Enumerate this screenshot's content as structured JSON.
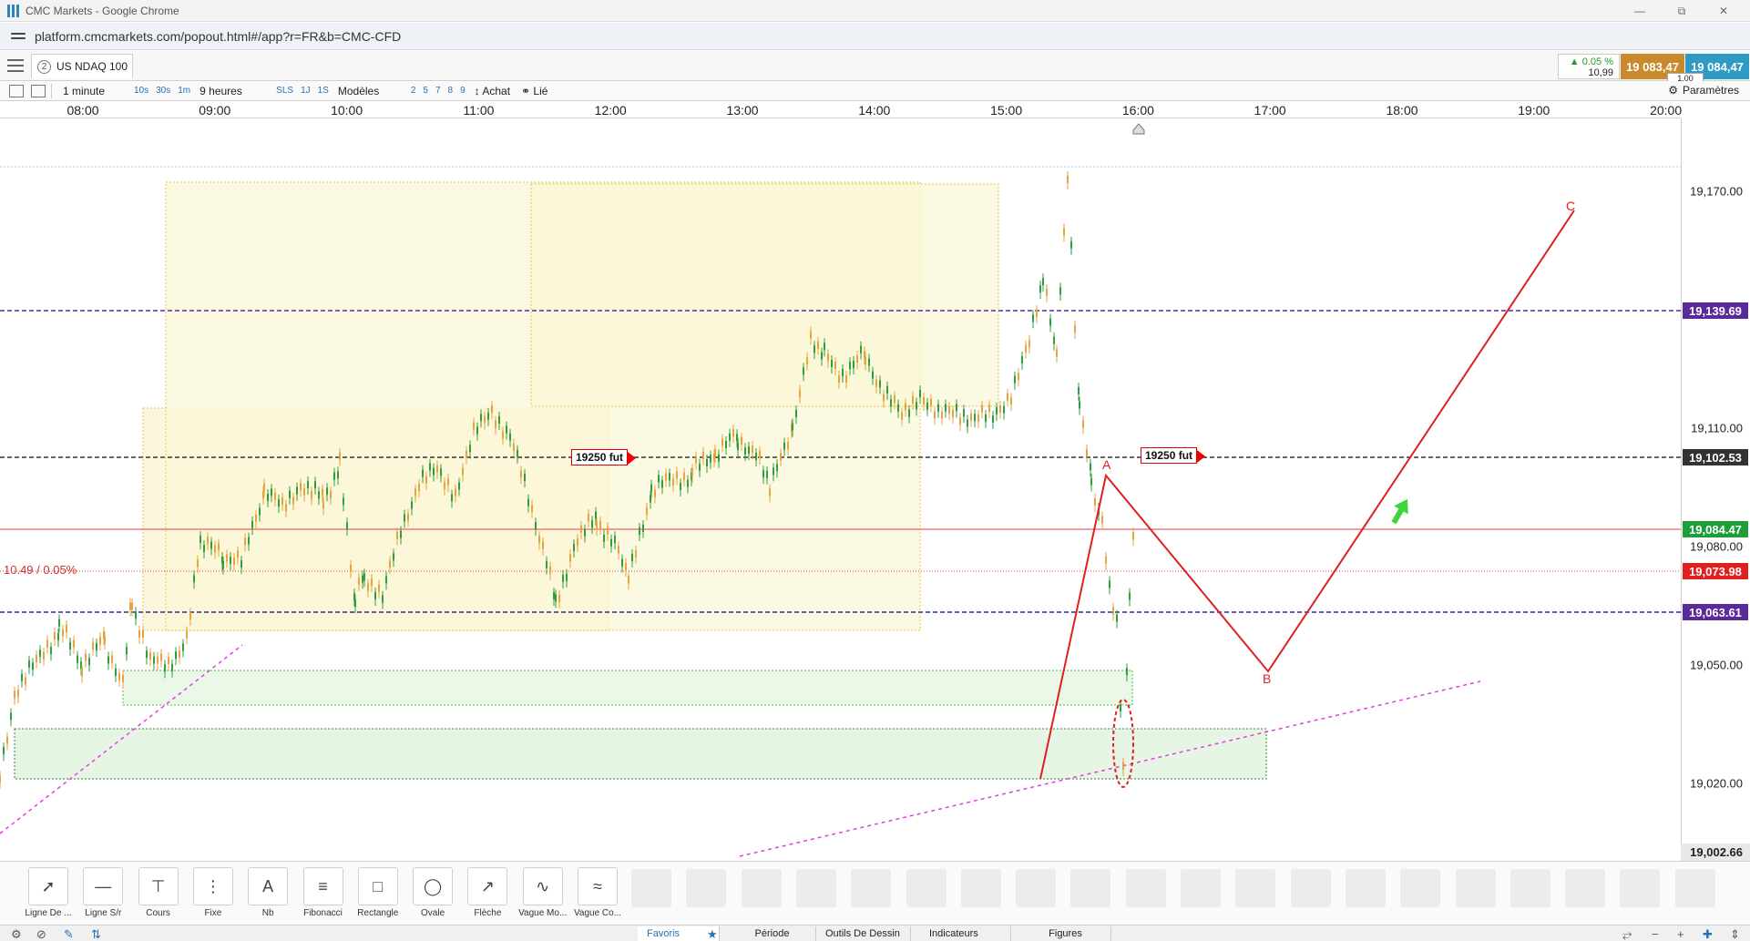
{
  "window": {
    "title": "CMC Markets - Google Chrome"
  },
  "browser": {
    "url": "platform.cmcmarkets.com/popout.html#/app?r=FR&b=CMC-CFD"
  },
  "instrument": {
    "badge": "2",
    "name": "US NDAQ 100",
    "change_pct": "▲ 0.05 %",
    "change_abs": "10,99",
    "sell_price": "19 083,47",
    "buy_price": "19 084,47",
    "spread": "1.00"
  },
  "toolbar": {
    "interval": "1 minute",
    "quick_intervals": [
      "10s",
      "30s",
      "1m"
    ],
    "range": "9 heures",
    "range_shortcuts": [
      "SLS",
      "1J",
      "1S"
    ],
    "models_label": "Modèles",
    "model_numbers": [
      "2",
      "5",
      "7",
      "8",
      "9"
    ],
    "buy_label": "Achat",
    "linked_label": "Lié",
    "settings_label": "Paramètres"
  },
  "time_axis": [
    "08:00",
    "09:00",
    "10:00",
    "11:00",
    "12:00",
    "13:00",
    "14:00",
    "15:00",
    "16:00",
    "17:00",
    "18:00",
    "19:00",
    "20:00"
  ],
  "price_axis": [
    "19,170.00",
    "19,110.00",
    "19,080.00",
    "19,050.00",
    "19,020.00"
  ],
  "price_tags": [
    {
      "value": "19,139.69",
      "color": "#5b2a9a"
    },
    {
      "value": "19,102.53",
      "color": "#333333"
    },
    {
      "value": "19,084.47",
      "color": "#1e9e3a"
    },
    {
      "value": "19,073.98",
      "color": "#e02020"
    },
    {
      "value": "19,063.61",
      "color": "#5b2a9a"
    }
  ],
  "bottom_price": "19,002.66",
  "annotations": {
    "future_label_1": "19250 fut",
    "future_label_2": "19250 fut",
    "pct_label": "10.49 / 0.05%",
    "wave_a": "A",
    "wave_b": "B",
    "wave_c": "C"
  },
  "drawing_tools": [
    {
      "label": "Ligne De ...",
      "icon": "trend-line-icon"
    },
    {
      "label": "Ligne S/r",
      "icon": "sr-line-icon"
    },
    {
      "label": "Cours",
      "icon": "price-line-icon"
    },
    {
      "label": "Fixe",
      "icon": "fixed-line-icon"
    },
    {
      "label": "Nb",
      "icon": "text-icon"
    },
    {
      "label": "Fibonacci",
      "icon": "fibonacci-icon"
    },
    {
      "label": "Rectangle",
      "icon": "rectangle-icon"
    },
    {
      "label": "Ovale",
      "icon": "ellipse-icon"
    },
    {
      "label": "Flèche",
      "icon": "arrow-icon"
    },
    {
      "label": "Vague Mo...",
      "icon": "wave-icon"
    },
    {
      "label": "Vague Co...",
      "icon": "corrective-wave-icon"
    }
  ],
  "bottom_tabs": {
    "favorites": "Favoris",
    "period": "Période",
    "drawing": "Outils De Dessin",
    "indicators": "Indicateurs",
    "figures": "Figures"
  },
  "colors": {
    "sell": "#c88a2d",
    "buy": "#2f9bc4",
    "bull": "#2e9e3e",
    "bear": "#e7a33c",
    "wave": "#e02020"
  }
}
